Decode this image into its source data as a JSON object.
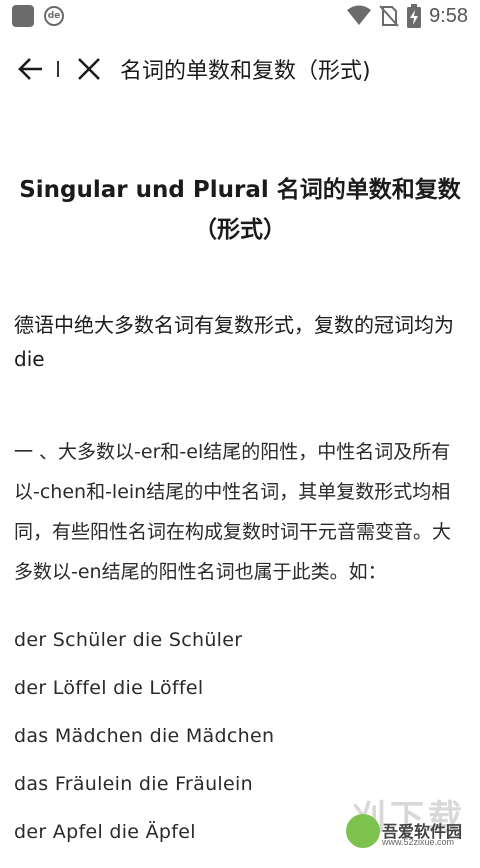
{
  "status_bar": {
    "time": "9:58",
    "app_icon_text": "de",
    "icons": [
      "notification-square-icon",
      "de-app-icon",
      "wifi-icon",
      "no-sim-icon",
      "battery-charging-icon"
    ]
  },
  "toolbar": {
    "title": "名词的单数和复数（形式)",
    "back_icon": "arrow-left-icon",
    "close_icon": "close-icon"
  },
  "article": {
    "heading": "Singular und Plural 名词的单数和复数（形式）",
    "intro": "德语中绝大多数名词有复数形式，复数的冠词均为die",
    "rule": "一 、大多数以-er和-el结尾的阳性，中性名词及所有以-chen和-lein结尾的中性名词，其单复数形式均相同，有些阳性名词在构成复数时词干元音需变音。大多数以-en结尾的阳性名词也属于此类。如：",
    "examples": [
      "der Schüler die Schüler",
      "der Löffel die Löffel",
      "das Mädchen die Mädchen",
      "das Fräulein die Fräulein",
      "der Apfel die Äpfel"
    ]
  },
  "watermark": {
    "glyphs": "刈下载",
    "name": "吾爱软件园",
    "url": "www.52zixue.com"
  },
  "colors": {
    "text": "#1b1b1b",
    "status_icon": "#6b6b6b",
    "watermark_green": "#7cc24c"
  }
}
